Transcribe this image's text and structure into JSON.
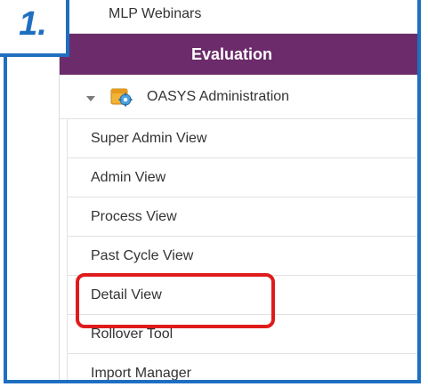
{
  "callout": {
    "step_label": "1."
  },
  "menu": {
    "top_item": "MLP Webinars",
    "section_header": "Evaluation",
    "tree_node": {
      "label": "OASYS Administration",
      "expanded": true,
      "icon": "admin-settings-icon"
    },
    "children": [
      "Super Admin View",
      "Admin View",
      "Process View",
      "Past Cycle View",
      "Detail View",
      "Rollover Tool",
      "Import Manager"
    ],
    "highlighted_item": "Detail View"
  },
  "colors": {
    "header_bg": "#6c2c6c",
    "frame": "#1f6fc1",
    "highlight": "#e01b1b"
  }
}
